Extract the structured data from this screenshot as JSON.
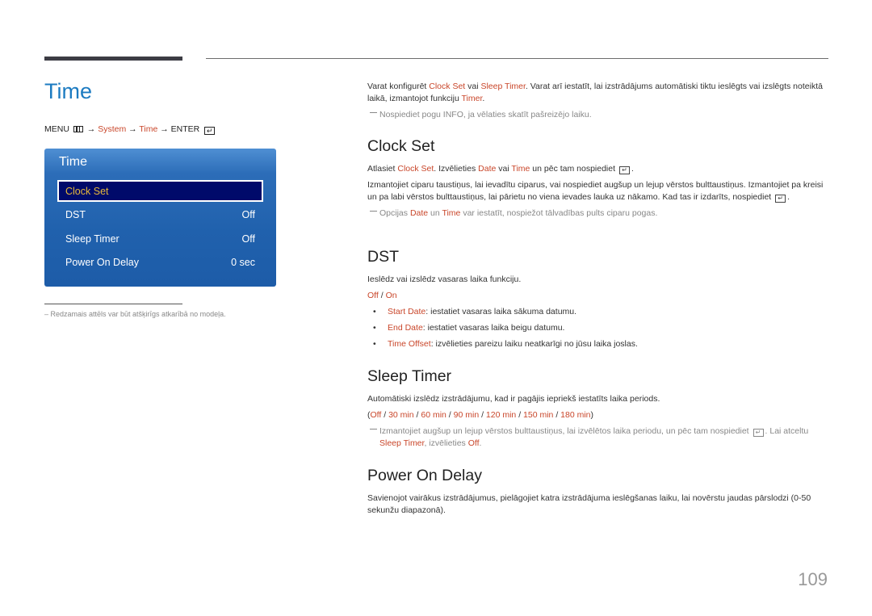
{
  "header": {
    "title": "Time"
  },
  "menu_path": {
    "menu": "MENU",
    "arrow": "→",
    "system": "System",
    "time": "Time",
    "enter": "ENTER",
    "enter_glyph": "↵"
  },
  "osd": {
    "title": "Time",
    "items": [
      {
        "label": "Clock Set",
        "value": ""
      },
      {
        "label": "DST",
        "value": "Off"
      },
      {
        "label": "Sleep Timer",
        "value": "Off"
      },
      {
        "label": "Power On Delay",
        "value": "0 sec"
      }
    ]
  },
  "footnote": "– Redzamais attēls var būt atšķirīgs atkarībā no modeļa.",
  "intro": {
    "p1_a": "Varat konfigurēt ",
    "p1_clock_set": "Clock Set",
    "p1_b": " vai ",
    "p1_sleep_timer": "Sleep Timer",
    "p1_c": ". Varat arī iestatīt, lai izstrādājums automātiski tiktu ieslēgts vai izslēgts noteiktā laikā, izmantojot funkciju ",
    "p1_timer": "Timer",
    "p1_d": ".",
    "note": "Nospiediet pogu INFO, ja vēlaties skatīt pašreizējo laiku."
  },
  "clock_set": {
    "heading": "Clock Set",
    "p1_a": "Atlasiet ",
    "p1_clock_set": "Clock Set",
    "p1_b": ". Izvēlieties ",
    "p1_date": "Date",
    "p1_c": " vai ",
    "p1_time": "Time",
    "p1_d": " un pēc tam nospiediet ",
    "p1_e": ".",
    "p2_a": "Izmantojiet ciparu taustiņus, lai ievadītu ciparus, vai nospiediet augšup un lejup vērstos bulttaustiņus. Izmantojiet pa kreisi un pa labi vērstos bulttaustiņus, lai pārietu no viena ievades lauka uz nākamo. Kad tas ir izdarīts, nospiediet ",
    "p2_b": ".",
    "note_a": "Opcijas ",
    "note_date": "Date",
    "note_b": " un ",
    "note_time": "Time",
    "note_c": " var iestatīt, nospiežot tālvadības pults ciparu pogas."
  },
  "dst": {
    "heading": "DST",
    "p1": "Ieslēdz vai izslēdz vasaras laika funkciju.",
    "opt_off": "Off",
    "opt_sep": " / ",
    "opt_on": "On",
    "bullets": [
      {
        "term": "Start Date",
        "text": ": iestatiet vasaras laika sākuma datumu."
      },
      {
        "term": "End Date",
        "text": ": iestatiet vasaras laika beigu datumu."
      },
      {
        "term": "Time Offset",
        "text": ": izvēlieties pareizu laiku neatkarīgi no jūsu laika joslas."
      }
    ]
  },
  "sleep_timer": {
    "heading": "Sleep Timer",
    "p1": "Automātiski izslēdz izstrādājumu, kad ir pagājis iepriekš iestatīts laika periods.",
    "options": [
      "Off",
      "30 min",
      "60 min",
      "90 min",
      "120 min",
      "150 min",
      "180 min"
    ],
    "note_a": "Izmantojiet augšup un lejup vērstos bulttaustiņus, lai izvēlētos laika periodu, un pēc tam nospiediet ",
    "note_b": ". Lai atceltu ",
    "note_sleep_timer": "Sleep Timer",
    "note_c": ", izvēlieties ",
    "note_off": "Off",
    "note_d": "."
  },
  "power_on_delay": {
    "heading": "Power On Delay",
    "p1": "Savienojot vairākus izstrādājumus, pielāgojiet katra izstrādājuma ieslēgšanas laiku, lai novērstu jaudas pārslodzi (0-50 sekunžu diapazonā)."
  },
  "page_number": "109"
}
